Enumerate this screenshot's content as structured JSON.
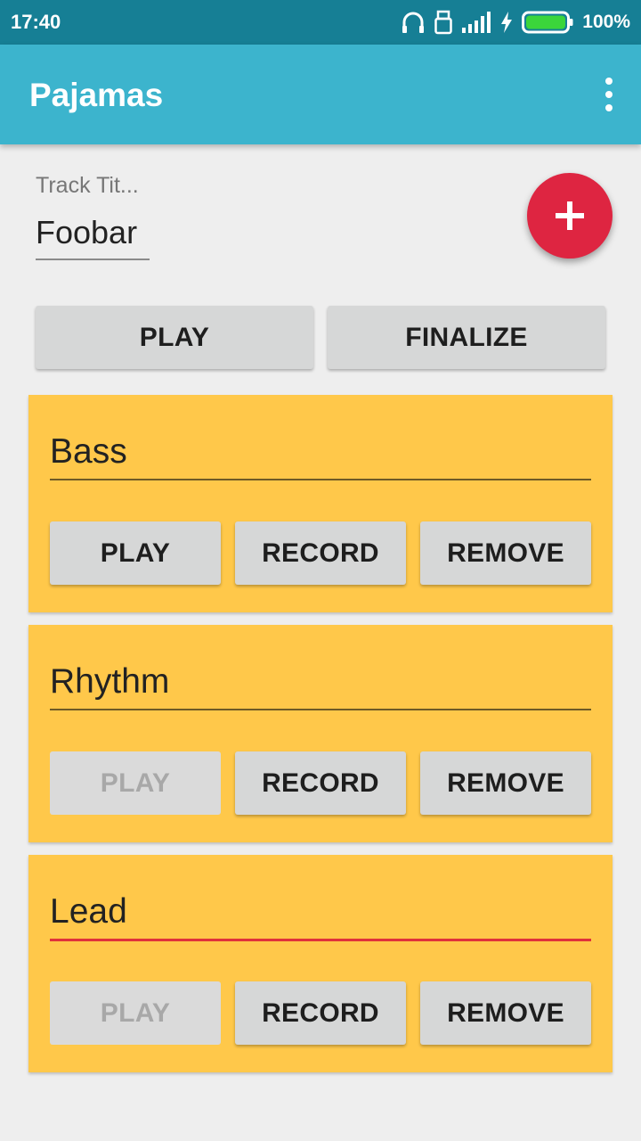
{
  "status_bar": {
    "time": "17:40",
    "battery_percent": "100%",
    "icons": [
      "headphones-icon",
      "usb-lock-icon",
      "signal-icon",
      "charging-icon",
      "battery-icon"
    ]
  },
  "app_bar": {
    "title": "Pajamas",
    "overflow_icon": "more-vert-icon"
  },
  "track": {
    "title_label": "Track Tit...",
    "title_value": "Foobar"
  },
  "fab": {
    "icon": "plus-icon"
  },
  "actions": {
    "play_label": "PLAY",
    "finalize_label": "FINALIZE"
  },
  "layers": [
    {
      "name": "Bass",
      "play_label": "PLAY",
      "record_label": "RECORD",
      "remove_label": "REMOVE",
      "play_enabled": true,
      "focused": false
    },
    {
      "name": "Rhythm",
      "play_label": "PLAY",
      "record_label": "RECORD",
      "remove_label": "REMOVE",
      "play_enabled": false,
      "focused": false
    },
    {
      "name": "Lead",
      "play_label": "PLAY",
      "record_label": "RECORD",
      "remove_label": "REMOVE",
      "play_enabled": false,
      "focused": true
    }
  ],
  "colors": {
    "status_bar": "#167f95",
    "app_bar": "#3cb4cd",
    "fab": "#de2541",
    "card": "#ffc84a",
    "button": "#d6d7d7",
    "focus_underline": "#e0323b"
  }
}
